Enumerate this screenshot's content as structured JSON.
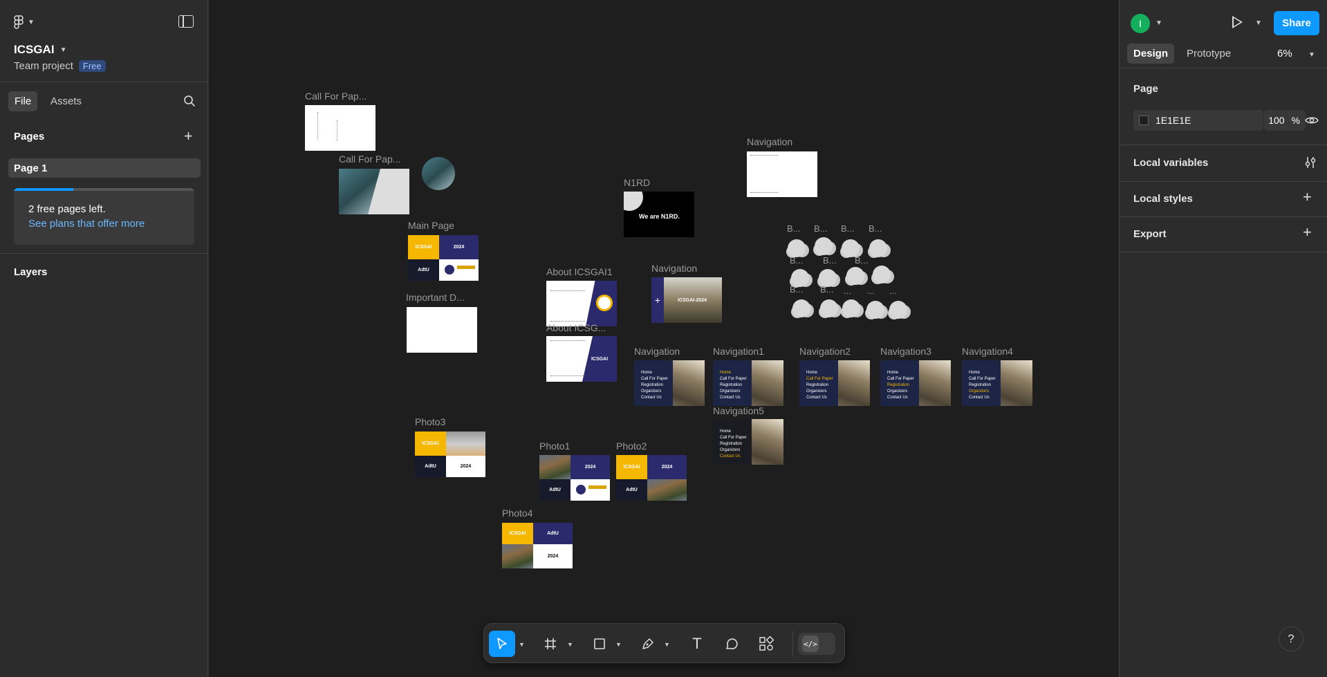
{
  "project": {
    "name": "ICSGAI",
    "subtitle": "Team project",
    "plan_badge": "Free"
  },
  "left_tabs": {
    "file": "File",
    "assets": "Assets"
  },
  "pages": {
    "header": "Pages",
    "items": [
      {
        "label": "Page 1"
      }
    ]
  },
  "free_pages": {
    "message": "2 free pages left.",
    "link": "See plans that offer more",
    "progress_percent": 33
  },
  "layers": {
    "header": "Layers"
  },
  "canvas": {
    "frames": {
      "callforpaper1": "Call For Pap...",
      "callforpaper2": "Call For Pap...",
      "mainpage": "Main Page",
      "important": "Important D...",
      "about1": "About ICSGAI1",
      "about2": "About ICSG...",
      "n1rd": "N1RD",
      "navigation_top": "Navigation",
      "navigation_mid": "Navigation",
      "navigation": "Navigation",
      "navigation1": "Navigation1",
      "navigation2": "Navigation2",
      "navigation3": "Navigation3",
      "navigation4": "Navigation4",
      "navigation5": "Navigation5",
      "photo1": "Photo1",
      "photo2": "Photo2",
      "photo3": "Photo3",
      "photo4": "Photo4"
    },
    "thumb_text": {
      "icsgai": "ICSGAI",
      "year": "2024",
      "adtu": "AdtU",
      "we_are": "We are N1RD.",
      "icsgai_2024": "ICSGAI-2024"
    },
    "nav_menu": [
      "Home",
      "Call For Paper",
      "Registration",
      "Organizers",
      "Contact Us"
    ],
    "b_labels": [
      "B...",
      "B...",
      "B...",
      "B...",
      "B...",
      "B...",
      "B...",
      "B...",
      "B...",
      "...",
      "...",
      "..."
    ]
  },
  "toolbar": {
    "tools": [
      "move-tool",
      "frame-tool",
      "shape-tool",
      "pen-tool",
      "text-tool",
      "comment-tool",
      "actions-tool"
    ],
    "text_glyph": "T",
    "dev_glyph": "</>"
  },
  "right_panel": {
    "avatar_initial": "I",
    "share_label": "Share",
    "tabs": {
      "design": "Design",
      "prototype": "Prototype"
    },
    "zoom": "6%",
    "page_section": "Page",
    "page_color": "1E1E1E",
    "page_opacity": "100",
    "percent_sign": "%",
    "local_variables": "Local variables",
    "local_styles": "Local styles",
    "export": "Export"
  },
  "help_label": "?",
  "colors": {
    "accent": "#0d99ff",
    "canvas_bg": "#1e1e1e",
    "panel_bg": "#2c2c2c",
    "avatar": "#14ae5c"
  }
}
